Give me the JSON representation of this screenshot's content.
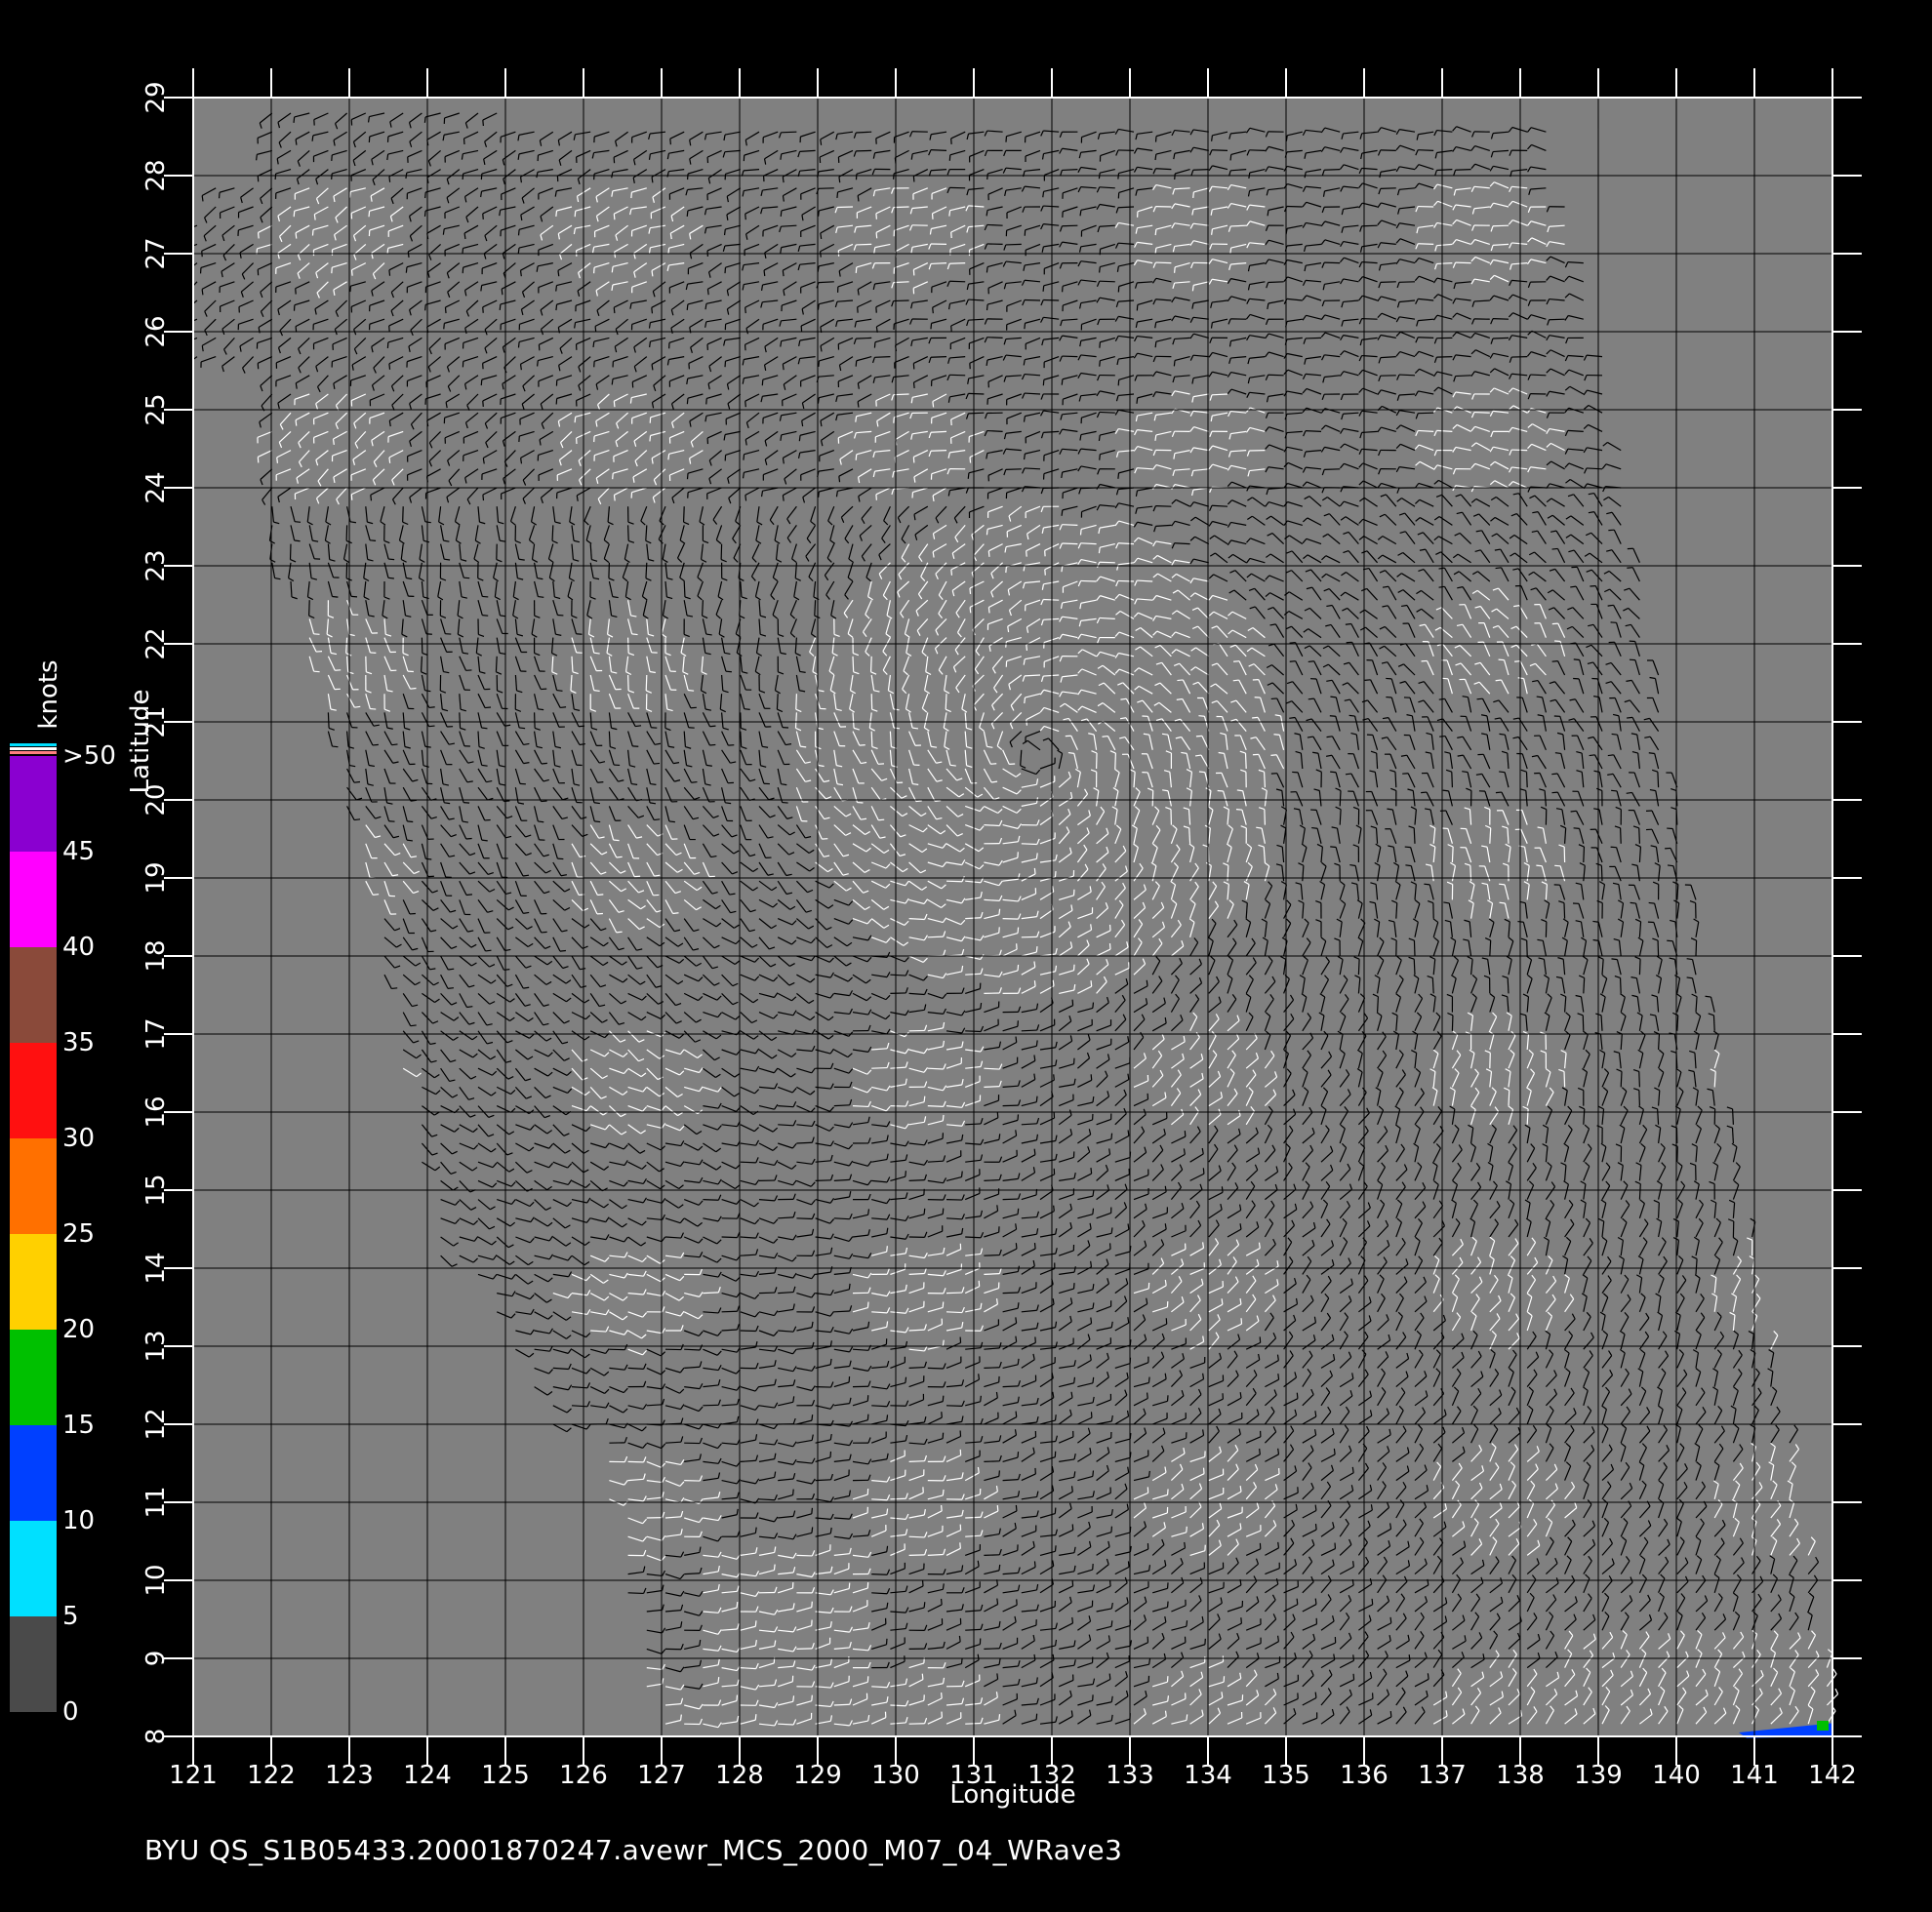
{
  "footer_text": "BYU  QS_S1B05433.20001870247.avewr_MCS_2000_M07_04_WRave3",
  "x_axis": {
    "label": "Longitude",
    "ticks": [
      "121",
      "122",
      "123",
      "124",
      "125",
      "126",
      "127",
      "128",
      "129",
      "130",
      "131",
      "132",
      "133",
      "134",
      "135",
      "136",
      "137",
      "138",
      "139",
      "140",
      "141",
      "142"
    ]
  },
  "y_axis": {
    "label": "Latitude",
    "ticks": [
      "8",
      "9",
      "10",
      "11",
      "12",
      "13",
      "14",
      "15",
      "16",
      "17",
      "18",
      "19",
      "20",
      "21",
      "22",
      "23",
      "24",
      "25",
      "26",
      "27",
      "28",
      "29"
    ]
  },
  "colorbar": {
    "unit": "knots",
    "labels": [
      "0",
      "5",
      "10",
      "15",
      "20",
      "25",
      "30",
      "35",
      "40",
      "45",
      ">50"
    ],
    "colors": [
      "#4a4a4a",
      "#00e0ff",
      "#0040ff",
      "#00c000",
      "#ffd000",
      "#ff7000",
      "#ff1010",
      "#8a4a3a",
      "#ff00ff",
      "#8a00d0"
    ]
  },
  "colors": {
    "background": "#000000",
    "land_or_no_data": "#808080",
    "grid": "#000000",
    "barb_dark": "#000000",
    "barb_light": "#ffffff"
  },
  "chart_data": {
    "type": "wind-barb-map",
    "xlim": [
      121,
      142
    ],
    "ylim": [
      8,
      29
    ],
    "cyclone_center": {
      "lon": 131.8,
      "lat": 20.6
    },
    "high_wind_spot": {
      "lon_range": [
        140.8,
        142
      ],
      "lat": 8.1,
      "speed_range_knots": [
        10,
        20
      ]
    },
    "grid": true
  }
}
